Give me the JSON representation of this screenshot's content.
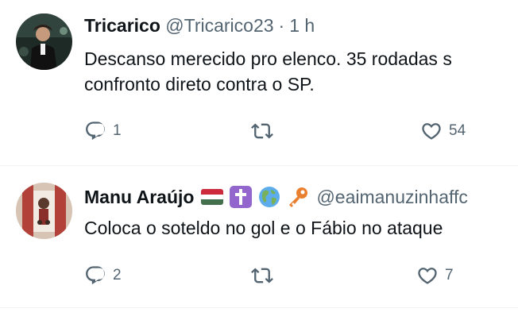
{
  "tweets": [
    {
      "name": "Tricarico",
      "handle": "@Tricarico23",
      "separator": "·",
      "time": "1 h",
      "text_line1": "Descanso merecido pro elenco. 35 rodadas s",
      "text_line2": "confronto direto contra o SP.",
      "replies": "1",
      "retweets": "",
      "likes": "54",
      "avatar_icon": "user-avatar-photo"
    },
    {
      "name": "Manu Araújo",
      "emojis": [
        "hungary-flag-emoji",
        "latin-cross-emoji",
        "globe-emoji",
        "key-emoji"
      ],
      "handle": "@eaimanuzinhaffc",
      "text_line1": "Coloca o soteldo no gol e o Fábio no ataque",
      "replies": "2",
      "retweets": "",
      "likes": "7",
      "avatar_icon": "user-avatar-photo"
    }
  ],
  "icons": {
    "reply": "reply-icon",
    "retweet": "retweet-icon",
    "like": "heart-icon"
  },
  "colors": {
    "text": "#0f1419",
    "secondary": "#536471",
    "divider": "#eff3f4"
  }
}
